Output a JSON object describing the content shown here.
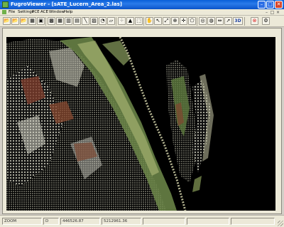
{
  "window": {
    "title": "FugroViewer - [sATE_Lucern_Area_2.las]",
    "minimize_glyph": "–",
    "maximize_glyph": "□",
    "close_glyph": "✕"
  },
  "menu": {
    "items": [
      "File",
      "Settings",
      "PCE",
      "ACE",
      "Window",
      "Help"
    ]
  },
  "toolbar": {
    "buttons": [
      {
        "icon": "open-folder-icon",
        "glyph": "📂"
      },
      {
        "icon": "open-folder-green-icon",
        "glyph": "📂"
      },
      {
        "icon": "open-folder-alt-icon",
        "glyph": "📂"
      },
      {
        "icon": "chart-window-icon",
        "glyph": "▦"
      },
      {
        "icon": "image-window-icon",
        "glyph": "▣"
      },
      {
        "icon": "color-palette-icon",
        "glyph": "▩"
      },
      {
        "icon": "grid-icon",
        "glyph": "▦"
      },
      {
        "icon": "rainbow-icon",
        "glyph": "▥"
      },
      {
        "icon": "grayscale-icon",
        "glyph": "▤"
      },
      {
        "icon": "draw-line-icon",
        "glyph": "╲"
      },
      {
        "icon": "elevation-map-icon",
        "glyph": "▨"
      },
      {
        "icon": "color-wheel-icon",
        "glyph": "◔"
      },
      {
        "icon": "profile-icon",
        "glyph": "▱"
      },
      {
        "icon": "scatter-points-icon",
        "glyph": "⁘"
      },
      {
        "icon": "triangle-icon",
        "glyph": "▲"
      },
      {
        "icon": "dotted-rect-icon",
        "glyph": "⬚"
      },
      {
        "icon": "hand-pan-icon",
        "glyph": "✋"
      },
      {
        "icon": "select-arrow-icon",
        "glyph": "↖"
      },
      {
        "icon": "zoom-window-icon",
        "glyph": "⤢"
      },
      {
        "icon": "zoom-in-icon",
        "glyph": "⊕"
      },
      {
        "icon": "crosshair-icon",
        "glyph": "✛"
      },
      {
        "icon": "polygon-icon",
        "glyph": "⬠"
      },
      {
        "icon": "rotate-view-icon",
        "glyph": "◎"
      },
      {
        "icon": "globe-icon",
        "glyph": "◍"
      },
      {
        "icon": "measure-icon",
        "glyph": "⇔"
      },
      {
        "icon": "flythrough-icon",
        "glyph": "➚"
      },
      {
        "icon": "3d-view-icon",
        "glyph": "3D"
      },
      {
        "icon": "stop-icon",
        "glyph": "⊗"
      },
      {
        "icon": "settings-icon",
        "glyph": "⚙"
      }
    ]
  },
  "status": {
    "mode": "ZOOM",
    "view": "D",
    "x": "446526.87",
    "y": "5212961.36"
  },
  "colors": {
    "title_bar": "#0a5fd8",
    "viewport_background": "#000000"
  }
}
